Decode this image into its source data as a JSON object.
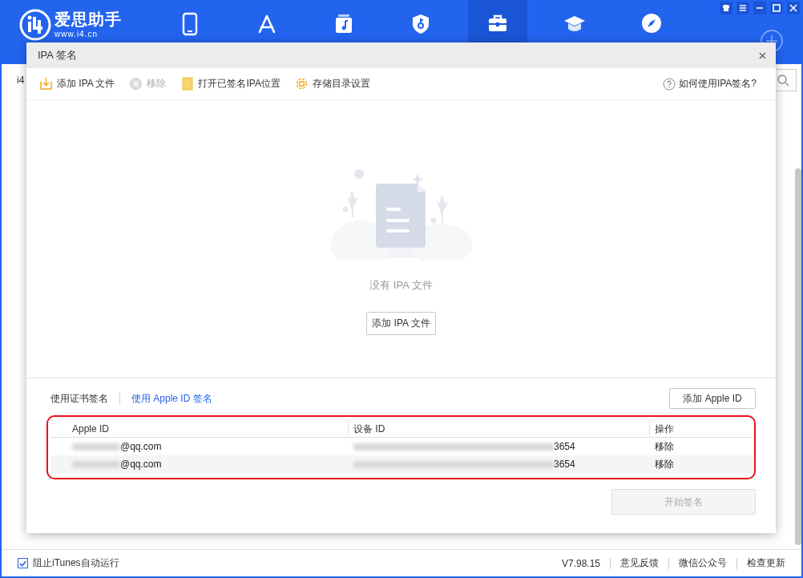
{
  "app": {
    "logo_title": "爱思助手",
    "logo_url": "www.i4.cn",
    "nav": [
      {
        "kind": "phone",
        "selected": false
      },
      {
        "kind": "appstore",
        "selected": false
      },
      {
        "kind": "music",
        "selected": false
      },
      {
        "kind": "shield",
        "selected": false
      },
      {
        "kind": "toolbox",
        "selected": true
      },
      {
        "kind": "cap",
        "selected": false
      },
      {
        "kind": "compass",
        "selected": false
      }
    ],
    "behind_label": "i4"
  },
  "dialog": {
    "title": "IPA 签名",
    "toolbar": [
      {
        "kind": "add",
        "label": "添加 IPA 文件",
        "disabled": false
      },
      {
        "kind": "remove",
        "label": "移除",
        "disabled": true
      },
      {
        "kind": "folder",
        "label": "打开已签名IPA位置",
        "disabled": false
      },
      {
        "kind": "gear",
        "label": "存储目录设置",
        "disabled": false
      }
    ],
    "help": "如何使用IPA签名?",
    "empty_text": "没有 IPA 文件",
    "empty_button": "添加 IPA 文件",
    "sign_tabs": [
      {
        "label": "使用证书签名",
        "selected": false
      },
      {
        "label": "使用 Apple ID 签名",
        "selected": true
      }
    ],
    "add_apple_id": "添加 Apple ID",
    "table": {
      "columns": [
        "Apple ID",
        "设备 ID",
        "操作"
      ],
      "rows": [
        {
          "apple_id": "@qq.com",
          "device_id": "3654",
          "action": "移除"
        },
        {
          "apple_id": "@qq.com",
          "device_id": "3654",
          "action": "移除"
        }
      ]
    },
    "start_button": {
      "label": "开始签名",
      "disabled": true
    }
  },
  "status_bar": {
    "itunes_block": {
      "label": "阻止iTunes自动运行",
      "checked": true
    },
    "version": "V7.98.15",
    "links": [
      "意见反馈",
      "微信公众号",
      "检查更新"
    ]
  }
}
